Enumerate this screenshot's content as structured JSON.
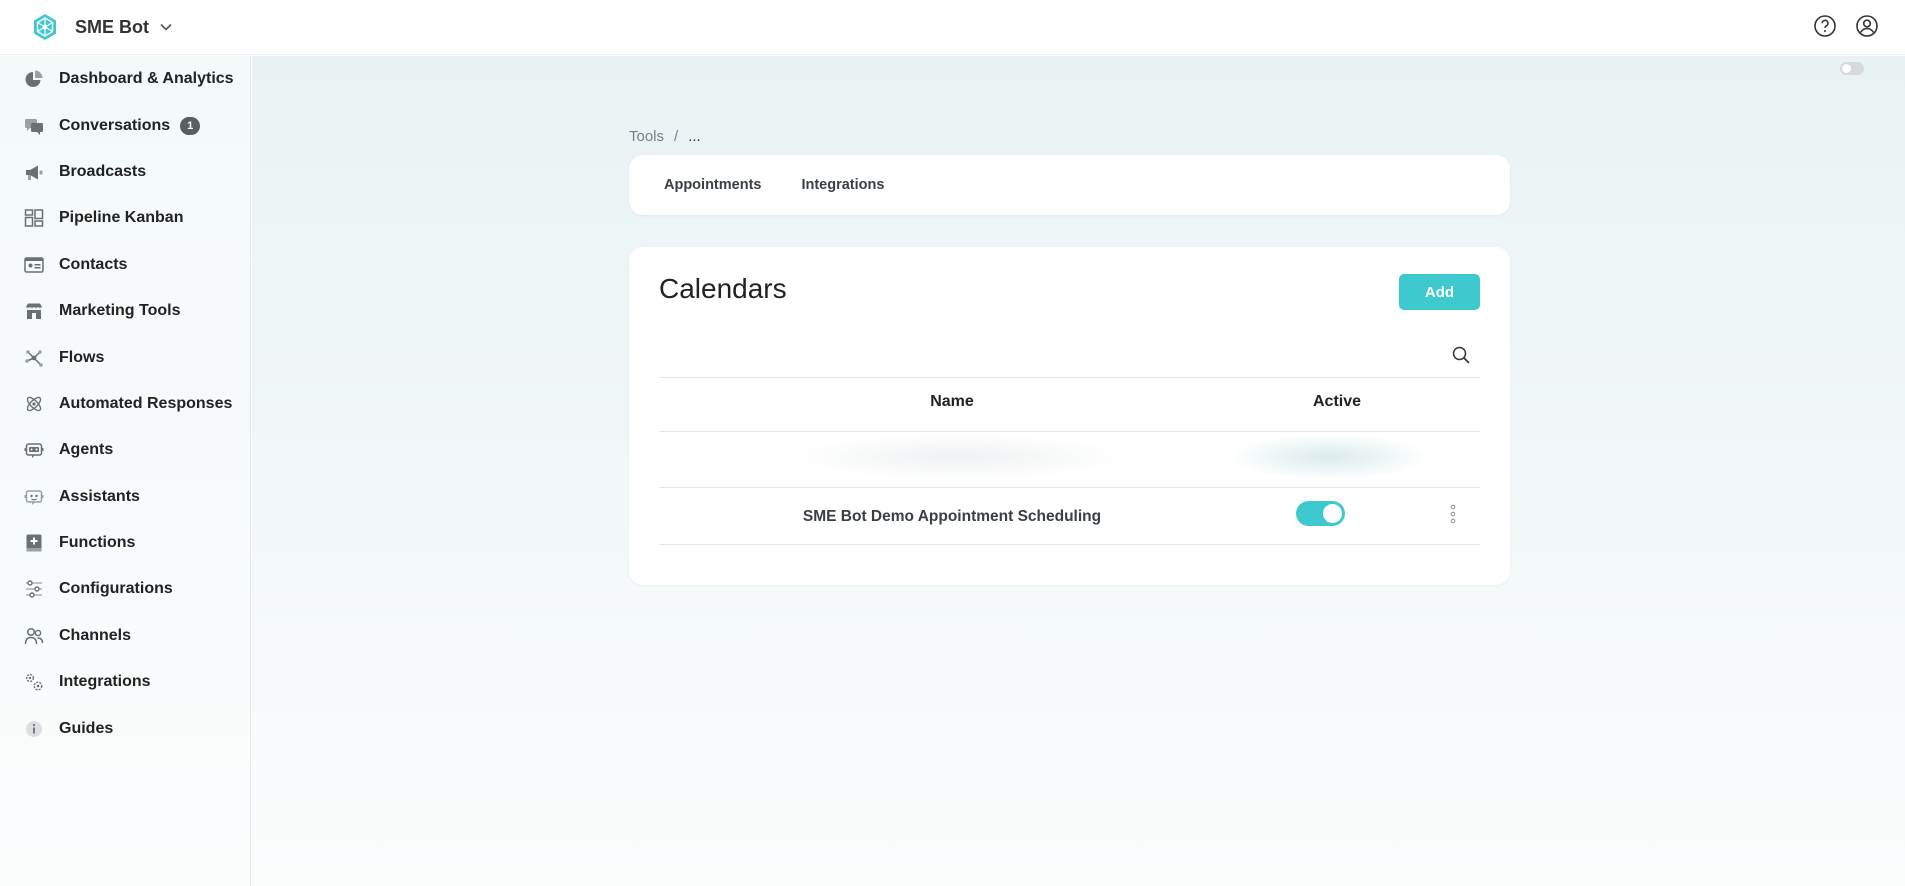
{
  "app": {
    "brand_name": "SME Bot",
    "accent_color": "#3ec9cf"
  },
  "sidebar": {
    "items": [
      {
        "label": "Dashboard & Analytics",
        "icon": "pie-chart-icon"
      },
      {
        "label": "Conversations",
        "icon": "chat-bubbles-icon",
        "badge": "1"
      },
      {
        "label": "Broadcasts",
        "icon": "megaphone-icon"
      },
      {
        "label": "Pipeline Kanban",
        "icon": "kanban-icon"
      },
      {
        "label": "Contacts",
        "icon": "contact-card-icon"
      },
      {
        "label": "Marketing Tools",
        "icon": "storefront-icon"
      },
      {
        "label": "Flows",
        "icon": "flow-nodes-icon"
      },
      {
        "label": "Automated Responses",
        "icon": "atom-icon"
      },
      {
        "label": "Agents",
        "icon": "agent-bot-icon"
      },
      {
        "label": "Assistants",
        "icon": "assistant-bot-icon"
      },
      {
        "label": "Functions",
        "icon": "function-book-icon"
      },
      {
        "label": "Configurations",
        "icon": "sliders-icon"
      },
      {
        "label": "Channels",
        "icon": "users-icon"
      },
      {
        "label": "Integrations",
        "icon": "gears-icon"
      },
      {
        "label": "Guides",
        "icon": "info-icon"
      }
    ]
  },
  "breadcrumb": {
    "root": "Tools",
    "separator": "/",
    "current": "..."
  },
  "tabs": [
    "Appointments",
    "Integrations"
  ],
  "calendars": {
    "title": "Calendars",
    "add_label": "Add",
    "columns": {
      "name": "Name",
      "active": "Active"
    },
    "rows": [
      {
        "name": "SME Bot Demo Appointment Scheduling",
        "active": true
      }
    ]
  }
}
